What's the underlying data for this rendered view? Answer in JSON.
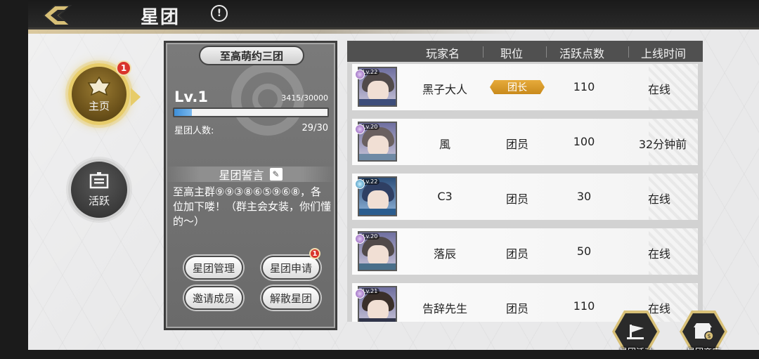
{
  "header": {
    "title": "星团",
    "info_symbol": "!"
  },
  "sidebar": {
    "items": [
      {
        "label": "主页",
        "badge": "1",
        "selected": true,
        "icon": "home-emblem-icon"
      },
      {
        "label": "活跃",
        "icon": "board-icon",
        "selected": false
      }
    ]
  },
  "guild": {
    "name": "至高萌约三团",
    "level": "Lv.1",
    "exp_text": "3415/30000",
    "exp_progress": 0.1138,
    "members_label": "星团人数:",
    "members_value": "29/30",
    "oath_title": "星团誓言",
    "oath_edit_icon": "pencil-icon",
    "oath_text": "至高主群⑨⑨③⑧⑥⑤⑨⑥⑧，各位加下喽！（群主会女装，你们懂的～）",
    "buttons": {
      "manage": "星团管理",
      "apply": "星团申请",
      "apply_badge": "1",
      "invite": "邀请成员",
      "disband": "解散星团"
    }
  },
  "table": {
    "headers": {
      "name": "玩家名",
      "role": "职位",
      "points": "活跃点数",
      "online": "上线时间"
    },
    "rows": [
      {
        "level": "Lv.22",
        "name": "黑子大人",
        "role": "团长",
        "points": "110",
        "online": "在线"
      },
      {
        "level": "Lv.20",
        "name": "風",
        "role": "团员",
        "points": "100",
        "online": "32分钟前"
      },
      {
        "level": "Lv.22",
        "name": "C3",
        "role": "团员",
        "points": "30",
        "online": "在线"
      },
      {
        "level": "Lv.20",
        "name": "落辰",
        "role": "团员",
        "points": "50",
        "online": "在线"
      },
      {
        "level": "Lv.21",
        "name": "告辞先生",
        "role": "团员",
        "points": "110",
        "online": "在线"
      }
    ]
  },
  "bottom_buttons": {
    "activity": "星团活动",
    "shop": "星团商店"
  },
  "colors": {
    "accent_gold": "#e7cc6a",
    "leader_badge": "#d99b2a",
    "notify_red": "#d9342b",
    "exp_blue": "#3e8fd8"
  }
}
